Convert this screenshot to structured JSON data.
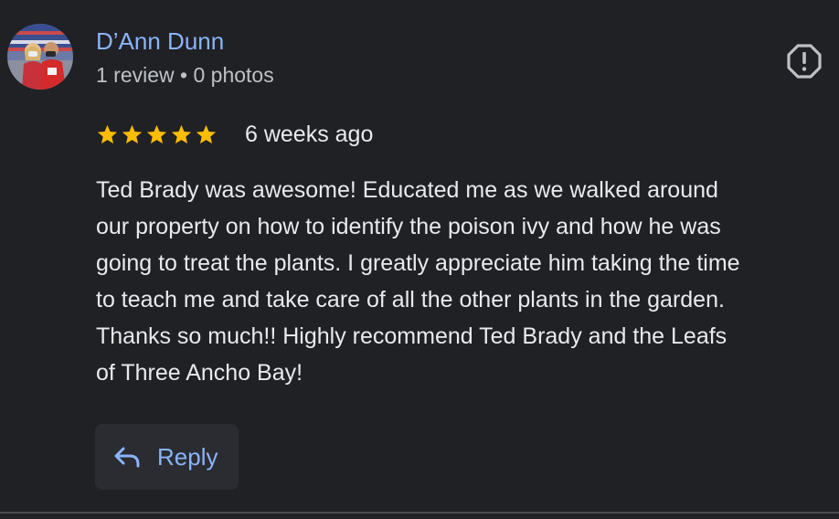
{
  "author": {
    "name": "D’Ann Dunn",
    "meta": "1 review • 0 photos",
    "avatar_icon": "avatar-photo"
  },
  "review": {
    "rating": 5,
    "rating_max": 5,
    "time_ago": "6 weeks ago",
    "text": "Ted Brady was awesome! Educated me as we walked around\nour property on how to identify the poison ivy and how he was\ngoing to treat the plants. I greatly appreciate him taking the time\nto teach me and take care of all the other plants in the garden.\nThanks so much!! Highly recommend Ted Brady and the Leafs\nof Three Ancho Bay!"
  },
  "actions": {
    "reply_label": "Reply",
    "reply_icon": "reply-arrow-icon",
    "report_icon": "report-icon"
  },
  "colors": {
    "background": "#202124",
    "name": "#8ab4f8",
    "star": "#fbbc04",
    "text": "#e8eaed",
    "meta": "#bdc1c6"
  }
}
